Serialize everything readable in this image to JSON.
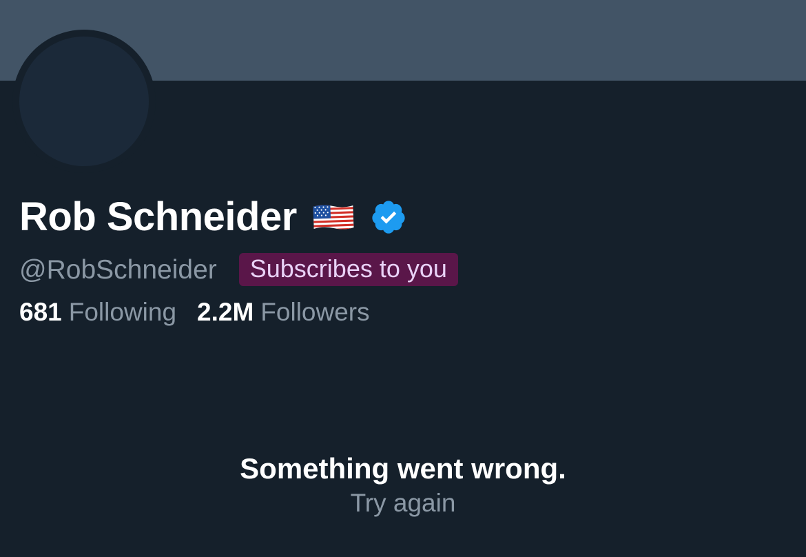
{
  "profile": {
    "display_name": "Rob Schneider",
    "flag_icon": "us-flag-emoji",
    "verified_icon": "verified-badge-icon",
    "handle": "@RobSchneider",
    "subscribes_badge": "Subscribes to you",
    "following_count": "681",
    "following_label": "Following",
    "followers_count": "2.2M",
    "followers_label": "Followers"
  },
  "error": {
    "title": "Something went wrong.",
    "retry_label": "Try again"
  },
  "colors": {
    "background": "#15202b",
    "banner": "#425466",
    "verified_blue": "#1d9bf0",
    "subscribe_badge_bg": "#5a1649",
    "muted_text": "#8b98a5"
  }
}
